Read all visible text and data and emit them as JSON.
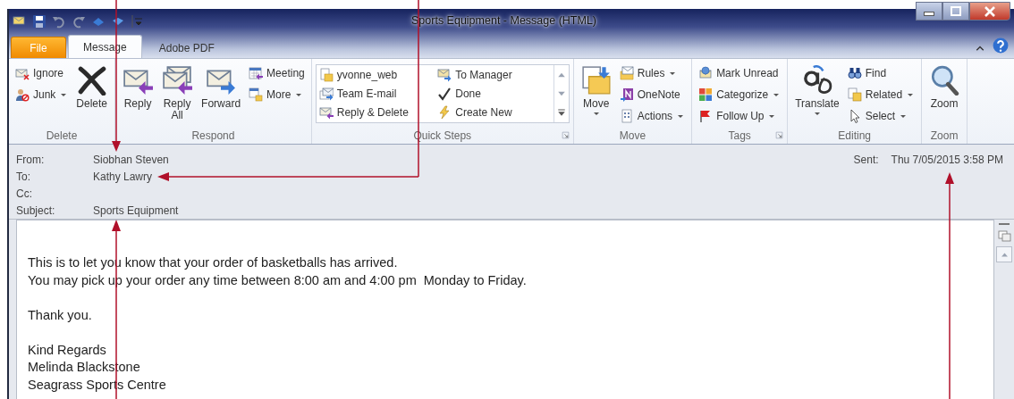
{
  "window": {
    "title": "Sports Equipment  -  Message (HTML)"
  },
  "tabs": [
    {
      "label": "File",
      "kind": "backstage",
      "selected": false
    },
    {
      "label": "Message",
      "kind": "tab",
      "selected": true
    },
    {
      "label": "Adobe PDF",
      "kind": "tab",
      "selected": false
    }
  ],
  "ribbon": {
    "groups": [
      {
        "label": "Delete",
        "kind": "buttons",
        "items": [
          {
            "label": "Ignore",
            "kind": "small",
            "dropdown": false
          },
          {
            "label": "Junk",
            "kind": "small",
            "dropdown": true
          },
          {
            "label": "Delete",
            "kind": "large",
            "dropdown": false
          }
        ]
      },
      {
        "label": "Respond",
        "kind": "buttons",
        "items": [
          {
            "label": "Reply",
            "kind": "large",
            "dropdown": false
          },
          {
            "label": "Reply All",
            "kind": "large",
            "dropdown": false
          },
          {
            "label": "Forward",
            "kind": "large",
            "dropdown": false
          },
          {
            "label": "Meeting",
            "kind": "small",
            "dropdown": false
          },
          {
            "label": "More",
            "kind": "small",
            "dropdown": true
          }
        ]
      },
      {
        "label": "Quick Steps",
        "kind": "gallery",
        "launcher": true,
        "items": [
          {
            "label": "yvonne_web"
          },
          {
            "label": "Team E-mail"
          },
          {
            "label": "Reply & Delete"
          },
          {
            "label": "To Manager"
          },
          {
            "label": "Done"
          },
          {
            "label": "Create New"
          }
        ]
      },
      {
        "label": "Move",
        "kind": "buttons",
        "items": [
          {
            "label": "Move",
            "kind": "large",
            "dropdown": true
          },
          {
            "label": "Rules",
            "kind": "small",
            "dropdown": true
          },
          {
            "label": "OneNote",
            "kind": "small",
            "dropdown": false
          },
          {
            "label": "Actions",
            "kind": "small",
            "dropdown": true
          }
        ]
      },
      {
        "label": "Tags",
        "kind": "buttons",
        "launcher": true,
        "items": [
          {
            "label": "Mark Unread",
            "kind": "small",
            "dropdown": false
          },
          {
            "label": "Categorize",
            "kind": "small",
            "dropdown": true
          },
          {
            "label": "Follow Up",
            "kind": "small",
            "dropdown": true
          }
        ]
      },
      {
        "label": "Editing",
        "kind": "buttons",
        "items": [
          {
            "label": "Translate",
            "kind": "large",
            "dropdown": true
          },
          {
            "label": "Find",
            "kind": "small",
            "dropdown": false
          },
          {
            "label": "Related",
            "kind": "small",
            "dropdown": true
          },
          {
            "label": "Select",
            "kind": "small",
            "dropdown": true
          }
        ]
      },
      {
        "label": "Zoom",
        "kind": "buttons",
        "items": [
          {
            "label": "Zoom",
            "kind": "large",
            "dropdown": false
          }
        ]
      }
    ]
  },
  "header": {
    "fields": [
      {
        "label": "From:",
        "value": "Siobhan Steven"
      },
      {
        "label": "To:",
        "value": "Kathy Lawry"
      },
      {
        "label": "Cc:"
      },
      {
        "label": "Subject:",
        "value": "Sports Equipment"
      }
    ],
    "sent": {
      "label": "Sent:",
      "value": "Thu 7/05/2015 3:58 PM"
    }
  },
  "body": {
    "paragraphs": [
      [
        "This is to let you know that your order of basketballs has arrived.",
        "You may pick up your order any time between 8:00 am and 4:00 pm  Monday to Friday."
      ],
      [
        "Thank you."
      ],
      [
        "Kind Regards",
        "Melinda Blackstone",
        "Seagrass Sports Centre"
      ]
    ]
  }
}
